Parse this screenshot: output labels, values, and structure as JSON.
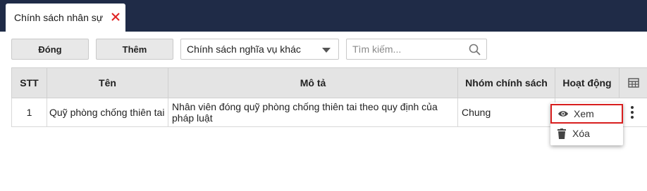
{
  "tab": {
    "label": "Chính sách nhân sự",
    "close_icon": "close-icon",
    "close_color": "#e02424"
  },
  "toolbar": {
    "close_label": "Đóng",
    "add_label": "Thêm",
    "filter_value": "Chính sách nghĩa vụ khác",
    "search_placeholder": "Tìm kiếm..."
  },
  "table": {
    "columns": [
      "STT",
      "Tên",
      "Mô tả",
      "Nhóm chính sách",
      "Hoạt động"
    ],
    "column_settings_icon": "table-grid-icon",
    "rows": [
      {
        "stt": "1",
        "name": "Quỹ phòng chống thiên tai",
        "description": "Nhân viên đóng quỹ phòng chống thiên tai theo quy định của pháp luật",
        "group": "Chung"
      }
    ]
  },
  "action_menu": {
    "items": [
      {
        "label": "Xem",
        "icon": "eye-icon"
      },
      {
        "label": "Xóa",
        "icon": "trash-icon"
      }
    ]
  },
  "colors": {
    "header_bg": "#1f2b47",
    "table_header_bg": "#e4e4e4",
    "highlight_border": "#d81e1e"
  }
}
